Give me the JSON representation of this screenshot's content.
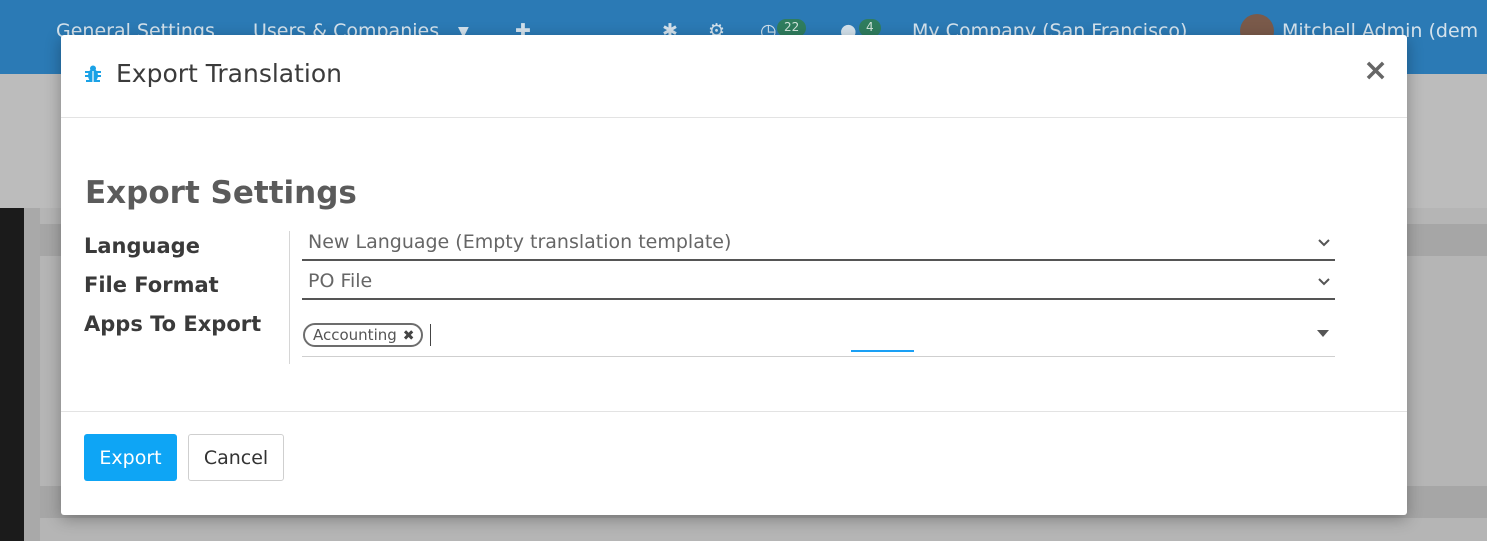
{
  "background": {
    "nav_general_settings": "General Settings",
    "nav_users_companies": "Users & Companies",
    "activity_count": "22",
    "messages_count": "4",
    "company": "My Company (San Francisco)",
    "user": "Mitchell Admin (dem"
  },
  "dialog": {
    "title": "Export Translation",
    "section_title": "Export Settings",
    "fields": {
      "language_label": "Language",
      "language_value": "New Language (Empty translation template)",
      "file_format_label": "File Format",
      "file_format_value": "PO File",
      "apps_label": "Apps To Export",
      "apps_tags": [
        "Accounting"
      ]
    },
    "buttons": {
      "export": "Export",
      "cancel": "Cancel"
    }
  },
  "colors": {
    "primary": "#0ea5f5",
    "topbar": "#2b7ab5"
  }
}
